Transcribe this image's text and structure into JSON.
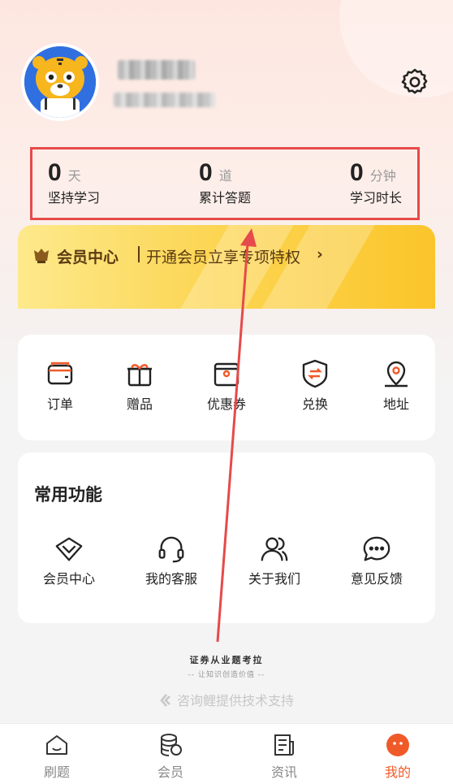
{
  "profile": {
    "avatar_icon": "tiger-avatar-icon",
    "settings_icon": "gear-icon"
  },
  "stats": [
    {
      "value": "0",
      "unit": "天",
      "label": "坚持学习"
    },
    {
      "value": "0",
      "unit": "道",
      "label": "累计答题"
    },
    {
      "value": "0",
      "unit": "分钟",
      "label": "学习时长"
    }
  ],
  "vip_banner": {
    "title": "会员中心",
    "description": "开通会员立享专项特权",
    "arrow": "›"
  },
  "orders": [
    {
      "label": "订单",
      "icon": "wallet-icon"
    },
    {
      "label": "赠品",
      "icon": "gift-icon"
    },
    {
      "label": "优惠券",
      "icon": "coupon-icon"
    },
    {
      "label": "兑换",
      "icon": "exchange-icon"
    },
    {
      "label": "地址",
      "icon": "location-icon"
    }
  ],
  "common": {
    "title": "常用功能",
    "items": [
      {
        "label": "会员中心",
        "icon": "diamond-icon"
      },
      {
        "label": "我的客服",
        "icon": "headset-icon"
      },
      {
        "label": "关于我们",
        "icon": "users-icon"
      },
      {
        "label": "意见反馈",
        "icon": "chat-icon"
      }
    ]
  },
  "footer": {
    "brand": "证券从业题考拉",
    "slogan": "-- 让知识创造价值 --",
    "support": "咨询鲤提供技术支持"
  },
  "tabs": [
    {
      "label": "刷题",
      "icon": "home-icon",
      "active": false
    },
    {
      "label": "会员",
      "icon": "coins-icon",
      "active": false
    },
    {
      "label": "资讯",
      "icon": "news-icon",
      "active": false
    },
    {
      "label": "我的",
      "icon": "profile-icon",
      "active": true
    }
  ],
  "colors": {
    "accent": "#f05a28",
    "highlight_box": "#e64a4a",
    "vip_text": "#5b3a12"
  }
}
